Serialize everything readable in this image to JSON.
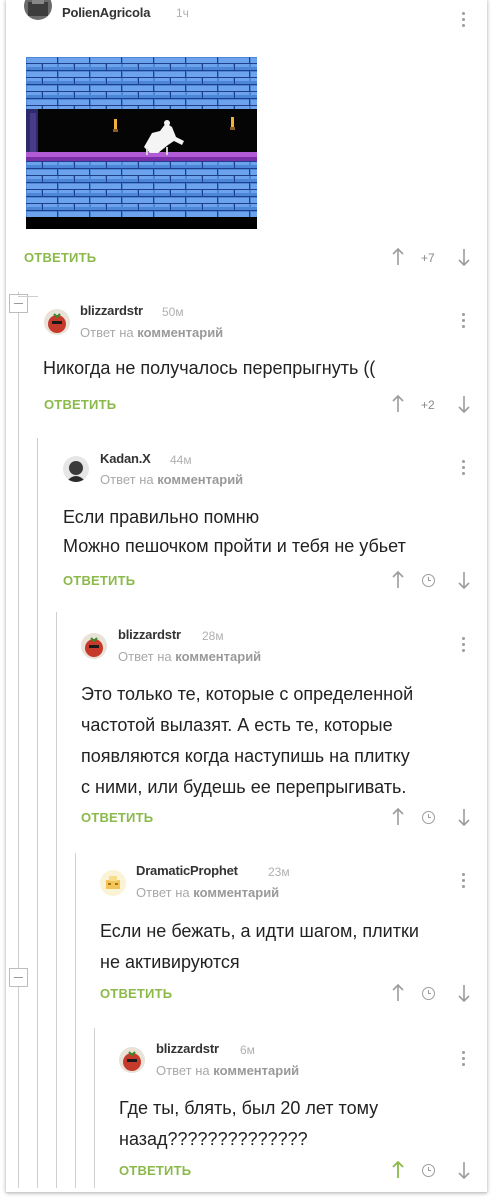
{
  "ui": {
    "reply_label": "ОТВЕТИТЬ",
    "reply_prefix": "Ответ на",
    "reply_target": "комментарий"
  },
  "colors": {
    "accent": "#8bb94a",
    "muted": "#a8a8a8",
    "arrow_active": "#8bb94a"
  },
  "top_post": {
    "username": "PolienAgricola",
    "time": "1ч",
    "score": "+7",
    "image_icon": "prince-of-persia-screenshot"
  },
  "comments": [
    {
      "username": "blizzardstr",
      "time": "50м",
      "lines": [
        "Никогда не получалось перепрыгнуть (("
      ],
      "score": "+2",
      "avatar_icon": "tomato-avatar"
    },
    {
      "username": "Kadan.X",
      "time": "44м",
      "lines": [
        "Если правильно помню",
        "Можно пешочком пройти и тебя не убьет"
      ],
      "avatar_icon": "dark-portrait-avatar"
    },
    {
      "username": "blizzardstr",
      "time": "28м",
      "lines": [
        "Это только те, которые с определенной",
        "частотой вылазят. А есть те, которые",
        "появляются когда наступишь на плитку",
        "с ними, или будешь ее перепрыгивать."
      ],
      "avatar_icon": "tomato-avatar"
    },
    {
      "username": "DramaticProphet",
      "time": "23м",
      "lines": [
        "Если не бежать, а идти шагом, плитки",
        "не активируются"
      ],
      "avatar_icon": "yellow-doodle-avatar"
    },
    {
      "username": "blizzardstr",
      "time": "6м",
      "lines": [
        "Где ты, блять, был 20 лет тому",
        "назад??????????????"
      ],
      "avatar_icon": "tomato-avatar"
    }
  ]
}
